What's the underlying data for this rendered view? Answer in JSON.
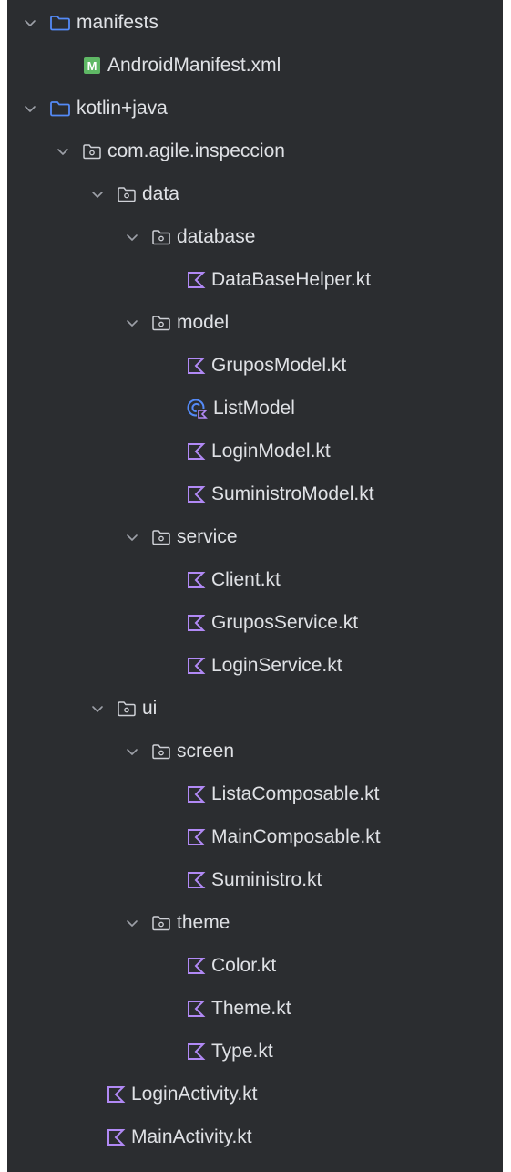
{
  "tree": [
    {
      "label": "manifests",
      "icon": "folder-icon",
      "expanded": true
    },
    {
      "label": "AndroidManifest.xml",
      "icon": "manifest-icon"
    },
    {
      "label": "kotlin+java",
      "icon": "folder-icon",
      "expanded": true
    },
    {
      "label": "com.agile.inspeccion",
      "icon": "package-icon",
      "expanded": true
    },
    {
      "label": "data",
      "icon": "package-icon",
      "expanded": true
    },
    {
      "label": "database",
      "icon": "package-icon",
      "expanded": true
    },
    {
      "label": "DataBaseHelper.kt",
      "icon": "kotlin-file-icon"
    },
    {
      "label": "model",
      "icon": "package-icon",
      "expanded": true
    },
    {
      "label": "GruposModel.kt",
      "icon": "kotlin-file-icon"
    },
    {
      "label": "ListModel",
      "icon": "kotlin-class-icon"
    },
    {
      "label": "LoginModel.kt",
      "icon": "kotlin-file-icon"
    },
    {
      "label": "SuministroModel.kt",
      "icon": "kotlin-file-icon"
    },
    {
      "label": "service",
      "icon": "package-icon",
      "expanded": true
    },
    {
      "label": "Client.kt",
      "icon": "kotlin-file-icon"
    },
    {
      "label": "GruposService.kt",
      "icon": "kotlin-file-icon"
    },
    {
      "label": "LoginService.kt",
      "icon": "kotlin-file-icon"
    },
    {
      "label": "ui",
      "icon": "package-icon",
      "expanded": true
    },
    {
      "label": "screen",
      "icon": "package-icon",
      "expanded": true
    },
    {
      "label": "ListaComposable.kt",
      "icon": "kotlin-file-icon"
    },
    {
      "label": "MainComposable.kt",
      "icon": "kotlin-file-icon"
    },
    {
      "label": "Suministro.kt",
      "icon": "kotlin-file-icon"
    },
    {
      "label": "theme",
      "icon": "package-icon",
      "expanded": true
    },
    {
      "label": "Color.kt",
      "icon": "kotlin-file-icon"
    },
    {
      "label": "Theme.kt",
      "icon": "kotlin-file-icon"
    },
    {
      "label": "Type.kt",
      "icon": "kotlin-file-icon"
    },
    {
      "label": "LoginActivity.kt",
      "icon": "kotlin-file-icon"
    },
    {
      "label": "MainActivity.kt",
      "icon": "kotlin-file-icon"
    }
  ],
  "colors": {
    "background": "#2b2d30",
    "text": "#dfe1e5",
    "folder": "#548af7",
    "package": "#ced0d6",
    "kotlin": "#b189f5",
    "manifest": "#5fb865",
    "chevron": "#9da0a8"
  }
}
